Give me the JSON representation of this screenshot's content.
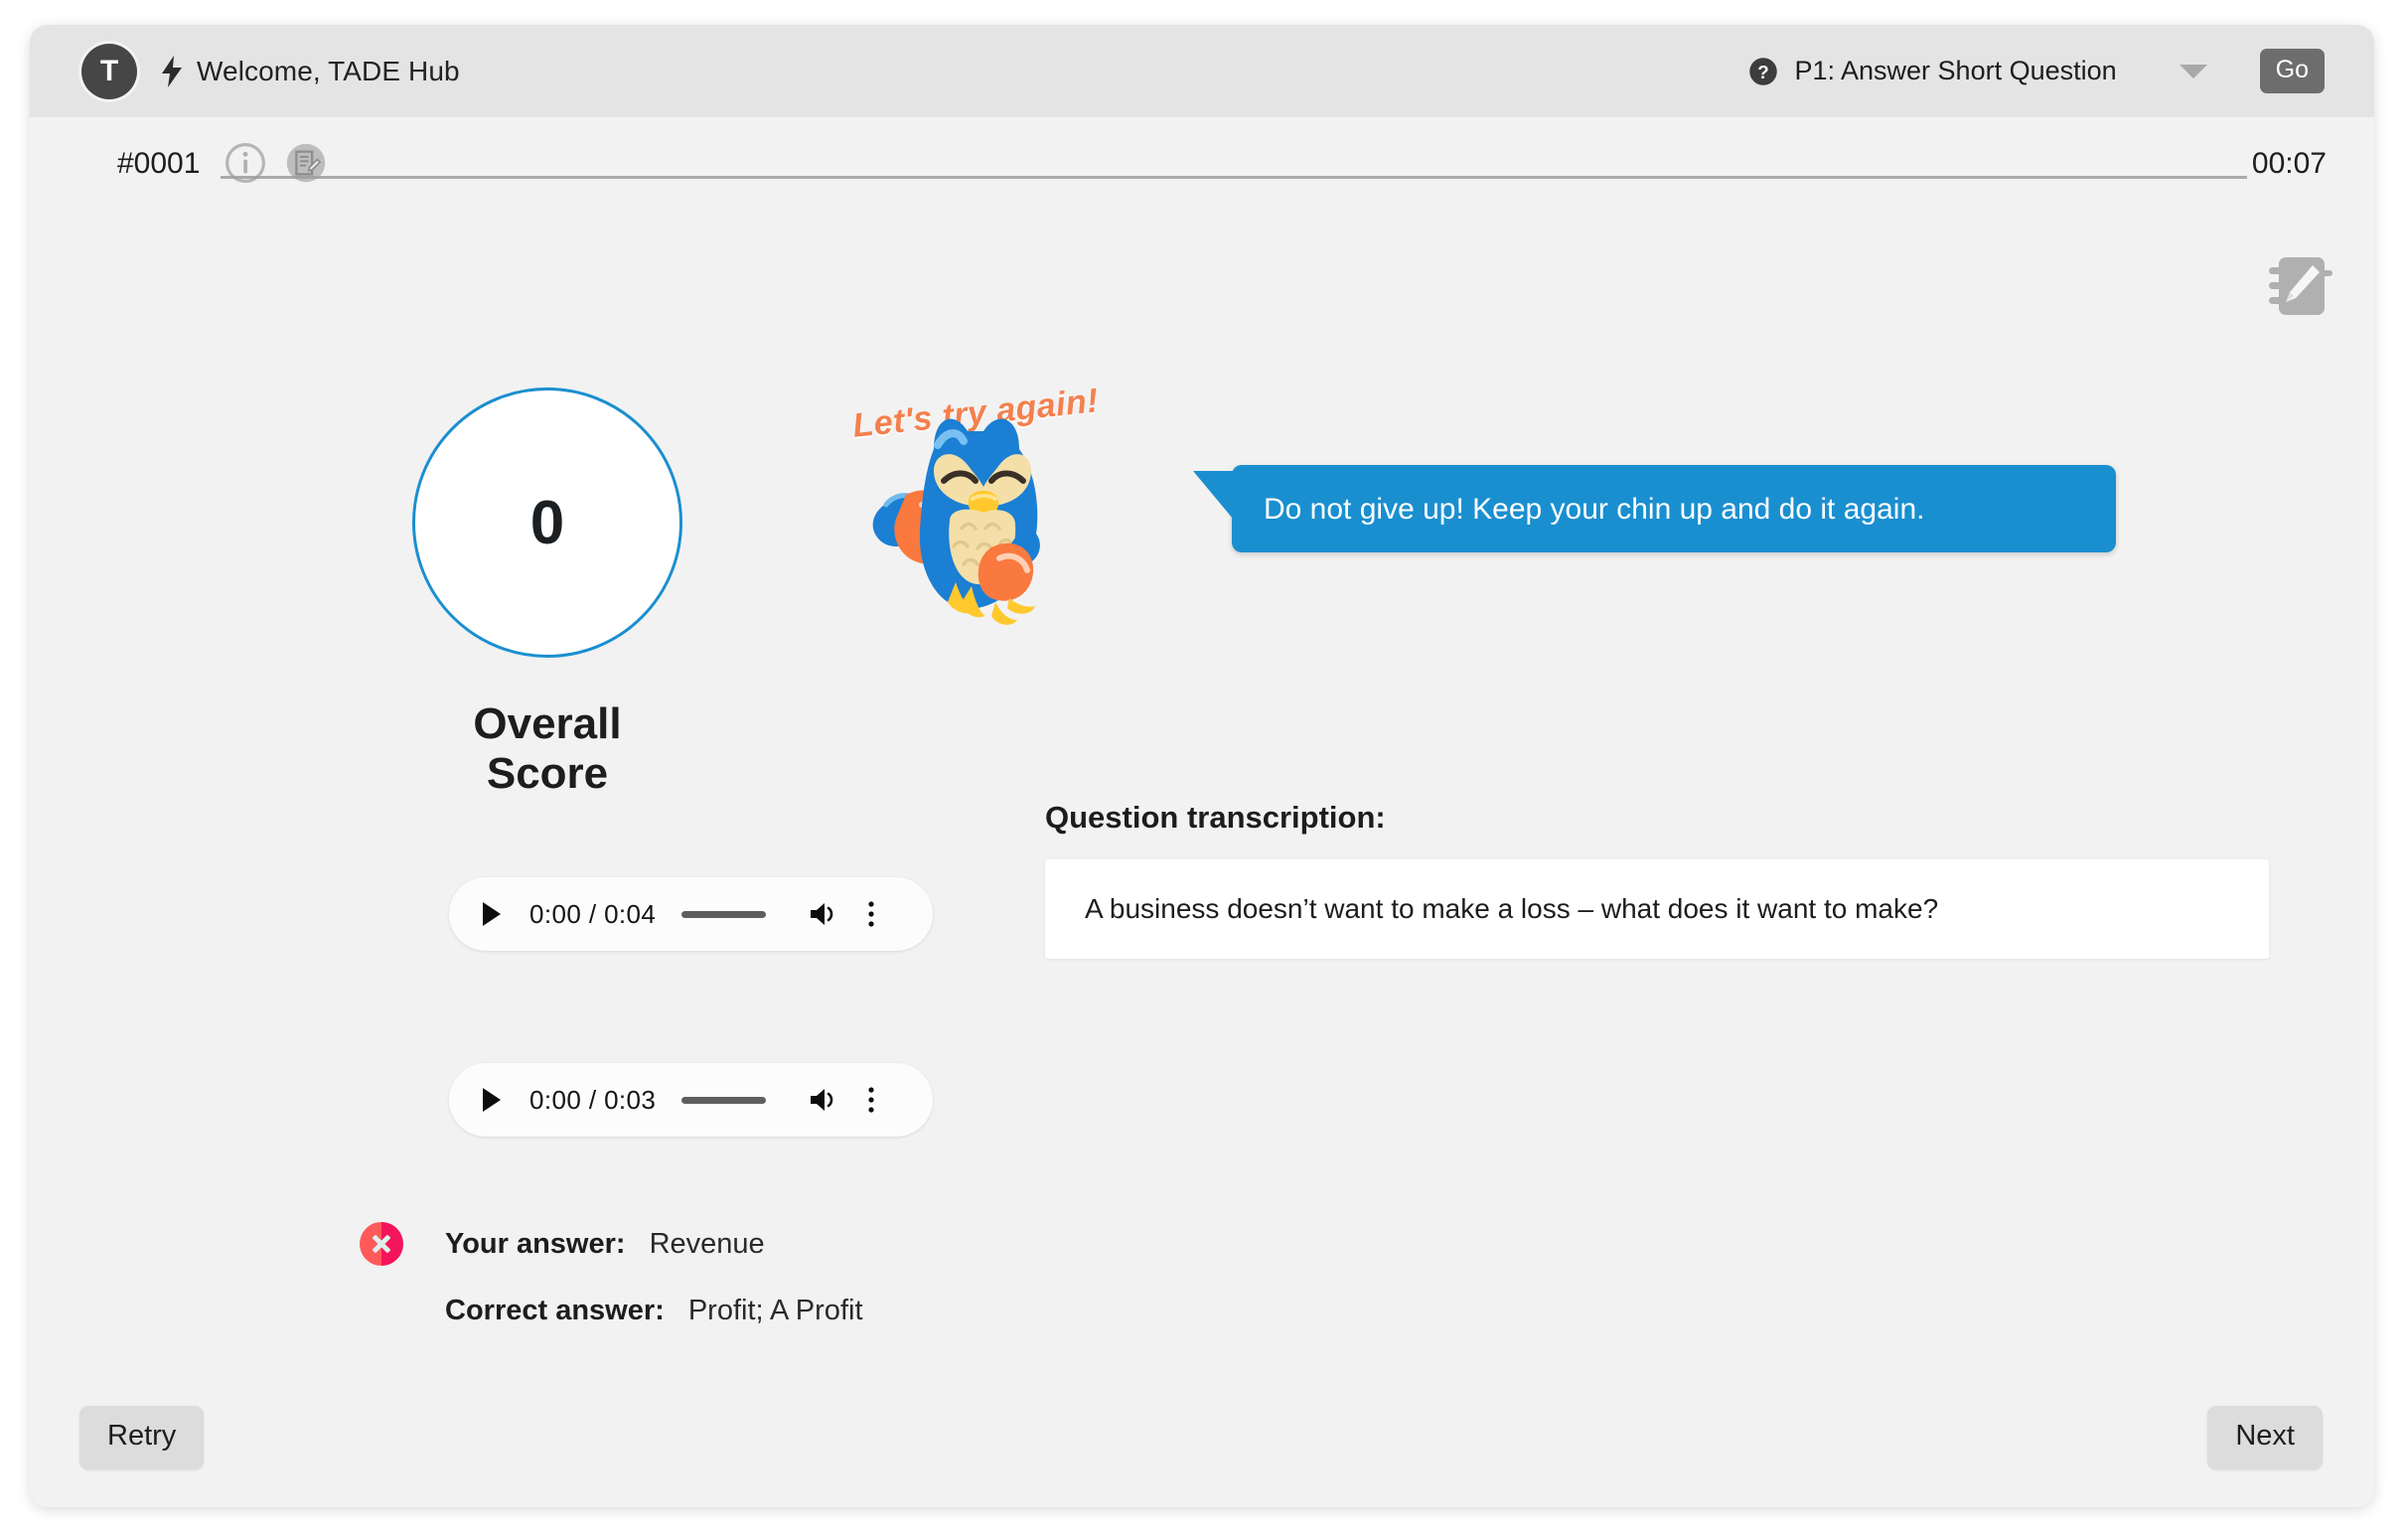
{
  "header": {
    "avatar_initial": "T",
    "bolt_icon": "bolt-icon",
    "welcome_text": "Welcome, TADE Hub",
    "help_icon": "help-circle-icon",
    "mode_label": "P1: Answer Short Question",
    "chevron_icon": "chevron-down-icon",
    "go_label": "Go"
  },
  "meta": {
    "question_id": "#0001",
    "info_icon": "info-icon",
    "note_icon": "note-edit-icon",
    "timer": "00:07",
    "notepad_icon": "notepad-pencil-icon"
  },
  "score": {
    "value": "0",
    "caption": "Overall Score",
    "ring_color": "#1a8fd0"
  },
  "mascot": {
    "caption": "Let's try again!",
    "caption_color": "#f4804e",
    "icon": "owl-mascot-icon"
  },
  "bubble": {
    "text": "Do not give up! Keep your chin up and do it again.",
    "color": "#1a8fd0"
  },
  "transcription": {
    "label": "Question transcription:",
    "text": "A business doesn’t want to make a loss – what does it want to make?"
  },
  "audio_players": [
    {
      "play_icon": "play-icon",
      "time": "0:00 / 0:04",
      "volume_icon": "volume-icon",
      "menu_icon": "more-vertical-icon"
    },
    {
      "play_icon": "play-icon",
      "time": "0:00 / 0:03",
      "volume_icon": "volume-icon",
      "menu_icon": "more-vertical-icon"
    }
  ],
  "answers": {
    "status_icon": "incorrect-x-icon",
    "status_color": "#f4145b",
    "your_answer_label": "Your answer:",
    "your_answer_value": "Revenue",
    "correct_answer_label": "Correct answer:",
    "correct_answer_value": "Profit; A Profit"
  },
  "footer": {
    "retry_label": "Retry",
    "next_label": "Next"
  }
}
